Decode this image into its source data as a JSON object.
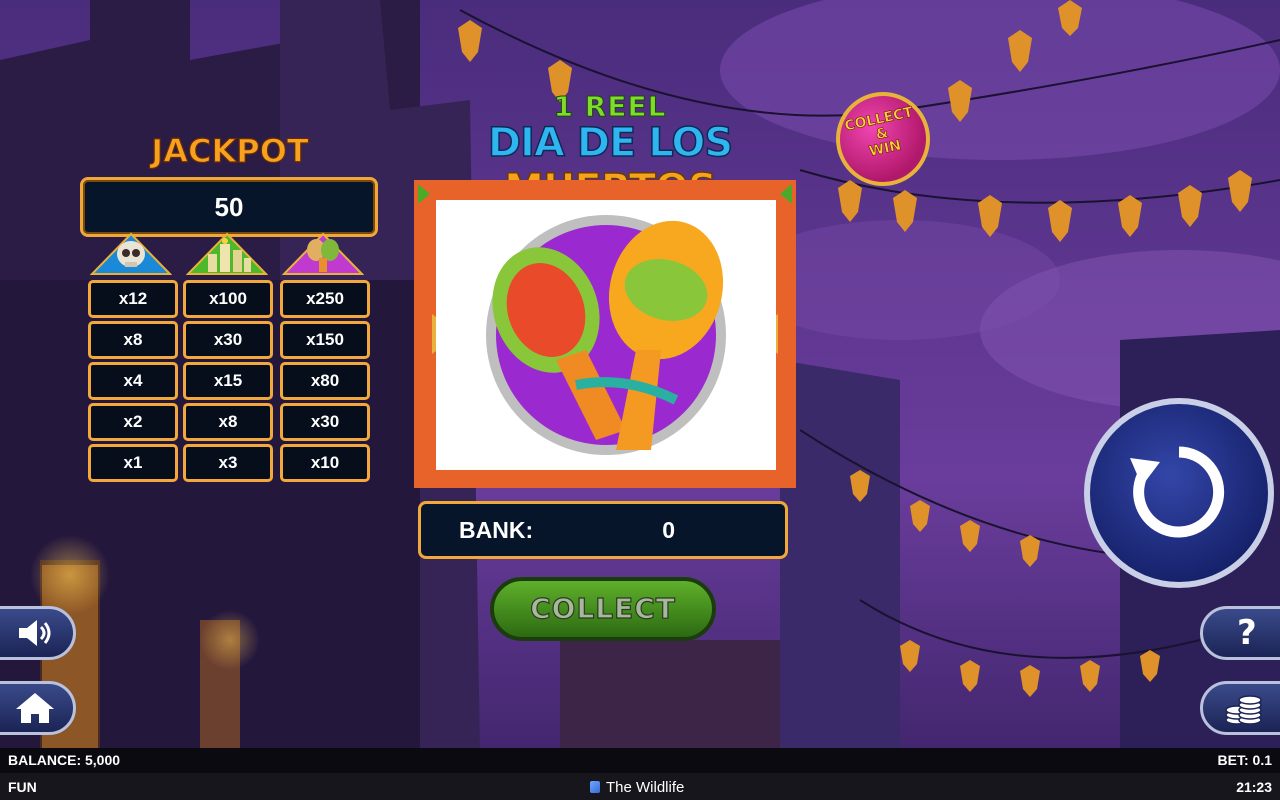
{
  "game": {
    "title_line1": "1 REEL",
    "title_line2_blue": "DIA DE LOS ",
    "title_line2_orange": "MUERTOS",
    "badge": {
      "line1": "COLLECT",
      "line2": "&",
      "line3": "WIN"
    }
  },
  "jackpot": {
    "title": "JACKPOT",
    "value": "50",
    "symbols": [
      "skull-icon",
      "candles-icon",
      "maracas-icon"
    ],
    "columns": [
      [
        "x12",
        "x8",
        "x4",
        "x2",
        "x1"
      ],
      [
        "x100",
        "x30",
        "x15",
        "x8",
        "x3"
      ],
      [
        "x250",
        "x150",
        "x80",
        "x30",
        "x10"
      ]
    ]
  },
  "reel": {
    "symbol": "maracas-icon"
  },
  "bank": {
    "label": "BANK:",
    "value": "0"
  },
  "collect_label": "COLLECT",
  "controls": [
    "sound-icon",
    "home-icon",
    "help-icon",
    "coins-icon",
    "spin-icon"
  ],
  "help_glyph": "?",
  "status": {
    "balance": "BALANCE: 5,000",
    "bet": "BET: 0.1",
    "mode": "FUN",
    "brand": "The Wildlife",
    "time": "21:23"
  }
}
